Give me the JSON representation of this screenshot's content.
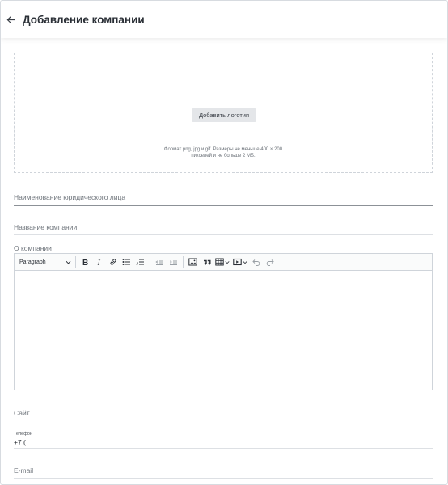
{
  "header": {
    "title": "Добавление компании",
    "back_icon": "arrow-left-icon"
  },
  "logo_upload": {
    "button_label": "Добавить логотип",
    "hint_line1": "Формат png, jpg и gif. Размеры не меньше 400 × 200",
    "hint_line2": "пикселей и не больше 2 МБ."
  },
  "form": {
    "legal_name_placeholder": "Наименование юридического лица",
    "company_name_placeholder": "Название компании",
    "about_label": "О компании",
    "site_placeholder": "Сайт",
    "phone_label": "Телефон",
    "phone_value": "+7 (",
    "email_placeholder": "E-mail"
  },
  "editor": {
    "block_format": "Paragraph",
    "tools": [
      "bold-icon",
      "italic-icon",
      "link-icon",
      "bulleted-list-icon",
      "numbered-list-icon",
      "outdent-icon",
      "indent-icon",
      "image-icon",
      "blockquote-icon",
      "table-icon",
      "media-icon",
      "undo-icon",
      "redo-icon"
    ]
  }
}
